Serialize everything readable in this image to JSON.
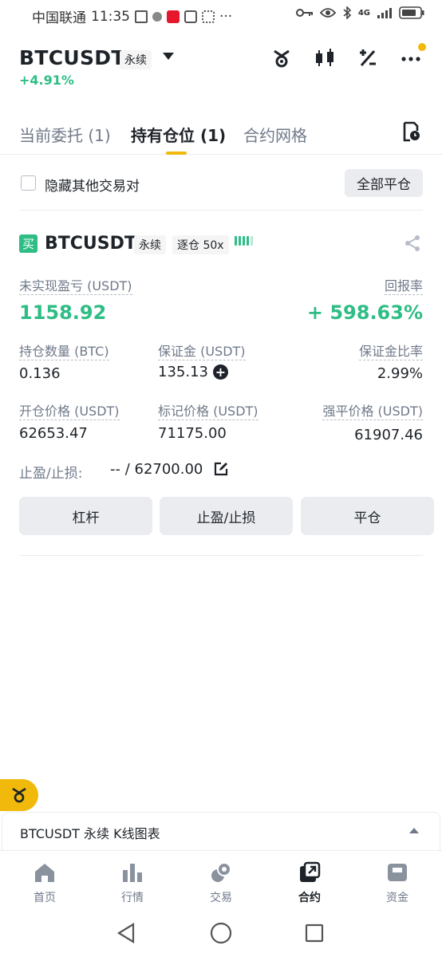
{
  "status_bar": {
    "carrier": "中国联通",
    "time": "11:35",
    "more": "···",
    "network": "4G",
    "battery_icon": "battery-icon"
  },
  "header": {
    "symbol": "BTCUSDT",
    "contract_type": "永续",
    "change_pct": "+4.91%",
    "icons": [
      "bot-icon",
      "candlestick-icon",
      "percent-icon",
      "more-icon"
    ],
    "notification_dot_color": "#f0b90b"
  },
  "tabs": [
    {
      "label": "当前委托 (1)"
    },
    {
      "label": "持有仓位 (1)"
    },
    {
      "label": "合约网格"
    }
  ],
  "filter": {
    "hide_others_label": "隐藏其他交易对",
    "close_all_label": "全部平仓"
  },
  "position": {
    "side_badge": "买",
    "symbol": "BTCUSDT",
    "contract_type": "永续",
    "margin_mode": "逐仓 50x",
    "unrealized_pnl_label": "未实现盈亏 (USDT)",
    "unrealized_pnl": "1158.92",
    "roe_label": "回报率",
    "roe": "+ 598.63%",
    "size_label": "持仓数量 (BTC)",
    "size": "0.136",
    "margin_label": "保证金 (USDT)",
    "margin": "135.13",
    "margin_ratio_label": "保证金比率",
    "margin_ratio": "2.99%",
    "entry_price_label": "开仓价格 (USDT)",
    "entry_price": "62653.47",
    "mark_price_label": "标记价格 (USDT)",
    "mark_price": "71175.00",
    "liq_price_label": "强平价格 (USDT)",
    "liq_price": "61907.46",
    "tpsl_label": "止盈/止损:",
    "tpsl_value": "-- / 62700.00",
    "actions": {
      "leverage": "杠杆",
      "tpsl": "止盈/止损",
      "close": "平仓"
    }
  },
  "chart_bar": {
    "label": "BTCUSDT 永续 K线图表"
  },
  "bottom_nav": [
    {
      "label": "首页",
      "icon": "home-icon"
    },
    {
      "label": "行情",
      "icon": "markets-icon"
    },
    {
      "label": "交易",
      "icon": "trade-icon"
    },
    {
      "label": "合约",
      "icon": "futures-icon"
    },
    {
      "label": "资金",
      "icon": "wallet-icon"
    }
  ],
  "colors": {
    "accent": "#f0b90b",
    "positive": "#2ebd85",
    "text": "#1e2329",
    "muted": "#707a8a"
  }
}
